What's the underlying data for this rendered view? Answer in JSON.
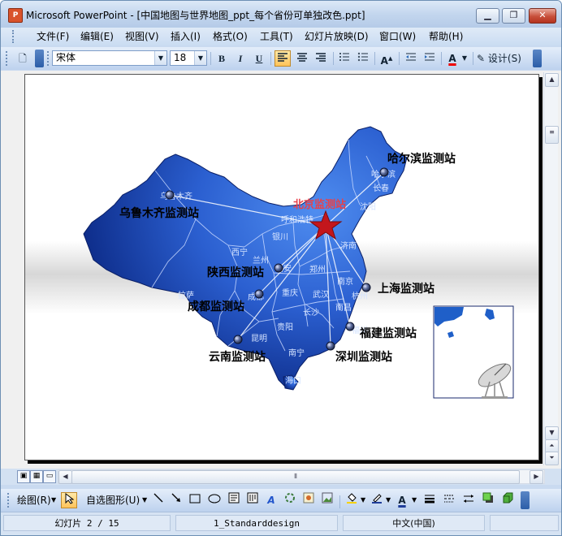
{
  "window": {
    "app_icon": "P",
    "title": "Microsoft PowerPoint - [中国地图与世界地图_ppt_每个省份可单独改色.ppt]"
  },
  "menu": [
    "文件(F)",
    "编辑(E)",
    "视图(V)",
    "插入(I)",
    "格式(O)",
    "工具(T)",
    "幻灯片放映(D)",
    "窗口(W)",
    "帮助(H)"
  ],
  "toolbar": {
    "font_name": "宋体",
    "font_size": "18",
    "bold": "B",
    "italic": "I",
    "underline": "U",
    "font_color_label": "A",
    "design_label": "设计(S)"
  },
  "slide": {
    "capital_label": "北京监测站",
    "stations": [
      {
        "name": "哈尔滨监测站"
      },
      {
        "name": "乌鲁木齐监测站"
      },
      {
        "name": "陕西监测站"
      },
      {
        "name": "成都监测站"
      },
      {
        "name": "上海监测站"
      },
      {
        "name": "福建监测站"
      },
      {
        "name": "云南监测站"
      },
      {
        "name": "深圳监测站"
      }
    ],
    "cities": [
      "乌鲁木齐",
      "哈尔滨",
      "长春",
      "沈阳",
      "呼和浩特",
      "银川",
      "兰州",
      "西宁",
      "郑州",
      "西安",
      "成都",
      "拉萨",
      "重庆",
      "武汉",
      "南京",
      "杭州",
      "南昌",
      "长沙",
      "贵阳",
      "昆明",
      "南宁",
      "海口",
      "福州",
      "济南"
    ],
    "colors": {
      "map_dark": "#0c2a86",
      "map_light": "#4f8df0",
      "star": "#c3161c",
      "capital_label": "#e8414a"
    }
  },
  "drawbar": {
    "draw_label": "绘图(R)",
    "autoshape_label": "自选图形(U)"
  },
  "status": {
    "slide_info": "幻灯片 2 / 15",
    "design": "1_Standarddesign",
    "language": "中文(中国)"
  }
}
